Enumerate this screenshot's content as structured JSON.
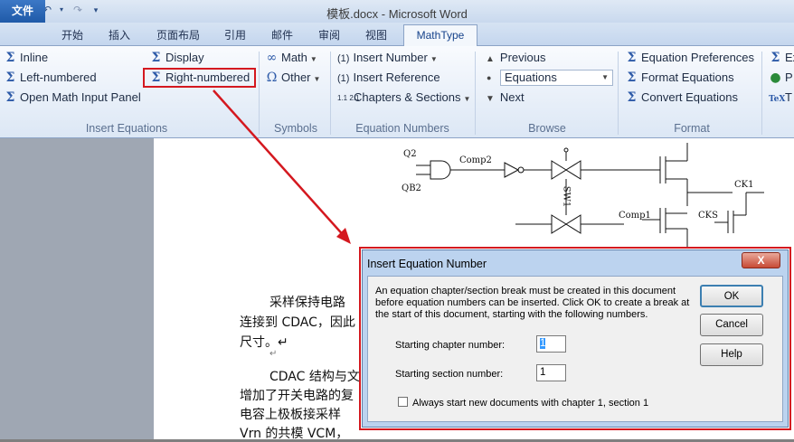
{
  "window": {
    "title": "模板.docx - Microsoft Word"
  },
  "quick_access": [
    "W",
    "save",
    "undo",
    "redo",
    "customize"
  ],
  "tabs": [
    "文件",
    "开始",
    "插入",
    "页面布局",
    "引用",
    "邮件",
    "审阅",
    "视图",
    "MathType"
  ],
  "ribbon": {
    "insert_equations": {
      "label": "Insert Equations",
      "inline": "Inline",
      "left_numbered": "Left-numbered",
      "open_math_input": "Open Math Input Panel",
      "display": "Display",
      "right_numbered": "Right-numbered"
    },
    "symbols": {
      "label": "Symbols",
      "math": "Math",
      "other": "Other"
    },
    "equation_numbers": {
      "label": "Equation Numbers",
      "insert_number": "Insert Number",
      "insert_number_prefix": "(1)",
      "insert_reference": "Insert Reference",
      "insert_reference_prefix": "(1)",
      "chapters_sections": "Chapters & Sections",
      "chapters_prefix": "1.1 2.1"
    },
    "browse": {
      "label": "Browse",
      "previous": "Previous",
      "equations": "Equations",
      "next": "Next"
    },
    "format": {
      "label": "Format",
      "equation_preferences": "Equation Preferences",
      "format_equations": "Format Equations",
      "convert_equations": "Convert Equations"
    },
    "overflow": [
      "Ex",
      "P",
      "T"
    ]
  },
  "document": {
    "circuit_labels": [
      "Q2",
      "QB2",
      "Comp2",
      "SW1",
      "Comp1",
      "CK1",
      "CKS"
    ],
    "line1": "采样保持电路",
    "line2": "连接到 CDAC，因此",
    "line3": "尺寸。↵",
    "line4": "↵",
    "line5": "CDAC 结构与文",
    "line6": "增加了开关电路的复",
    "line7": "电容上极板接采样",
    "line8": "Vrn 的共模 VCM，"
  },
  "dialog": {
    "title": "Insert Equation Number",
    "close": "X",
    "message_line1": "An equation chapter/section break must be created in this document",
    "message_line2": "before equation numbers can be inserted. Click OK to create a break at",
    "message_line3": "the start of this document, starting with the following numbers.",
    "chapter_label": "Starting chapter number:",
    "chapter_value": "1",
    "section_label": "Starting section number:",
    "section_value": "1",
    "always_label": "Always start new documents with chapter 1, section 1",
    "ok": "OK",
    "cancel": "Cancel",
    "help": "Help"
  }
}
